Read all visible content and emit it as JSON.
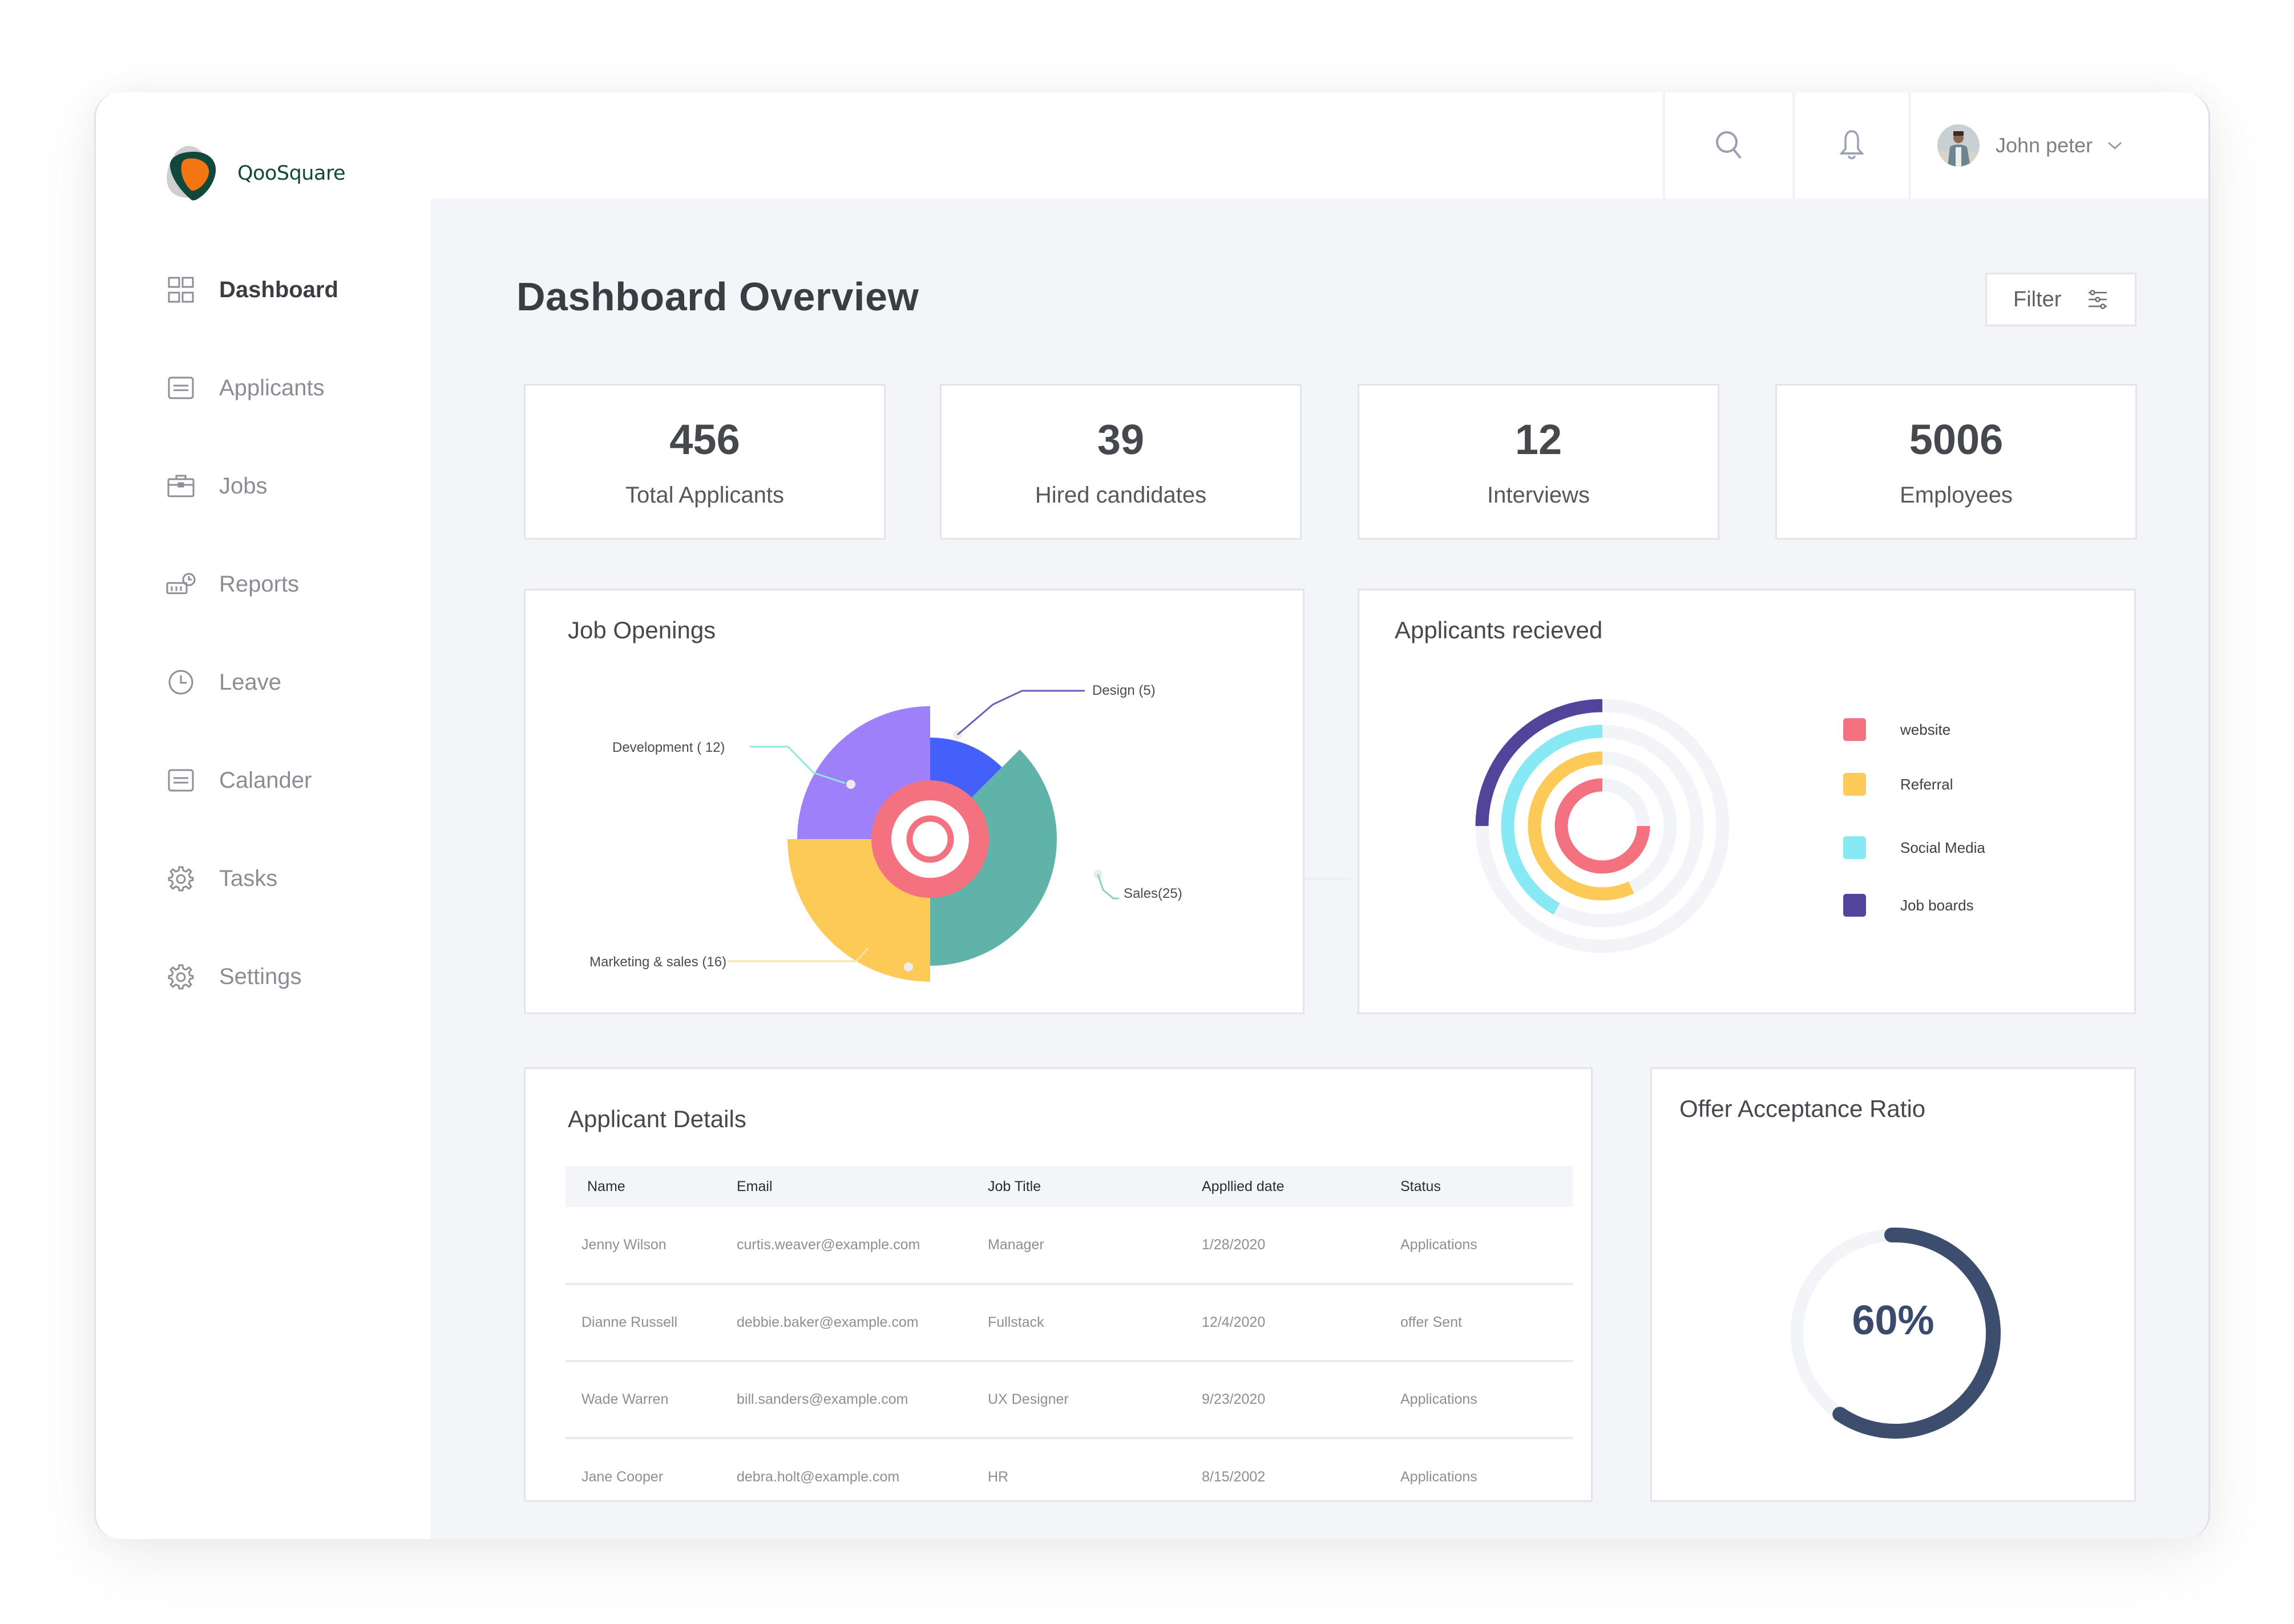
{
  "brand": {
    "name": "QooSquare",
    "logo_icon": "shield-logo"
  },
  "sidebar": {
    "items": [
      {
        "label": "Dashboard",
        "icon": "grid-icon",
        "active": true
      },
      {
        "label": "Applicants",
        "icon": "list-card-icon",
        "active": false
      },
      {
        "label": "Jobs",
        "icon": "briefcase-icon",
        "active": false
      },
      {
        "label": "Reports",
        "icon": "reports-icon",
        "active": false
      },
      {
        "label": "Leave",
        "icon": "clock-icon",
        "active": false
      },
      {
        "label": "Calander",
        "icon": "list-card-icon",
        "active": false
      },
      {
        "label": "Tasks",
        "icon": "gear-icon",
        "active": false
      },
      {
        "label": "Settings",
        "icon": "gear-icon",
        "active": false
      }
    ]
  },
  "topbar": {
    "search_icon": "search-icon",
    "notification_icon": "bell-icon",
    "user": {
      "name": "John peter",
      "dropdown_icon": "chevron-down-icon"
    }
  },
  "page": {
    "title": "Dashboard Overview",
    "filter_label": "Filter",
    "filter_icon": "sliders-icon"
  },
  "stats": [
    {
      "value": "456",
      "label": "Total Applicants"
    },
    {
      "value": "39",
      "label": "Hired candidates"
    },
    {
      "value": "12",
      "label": "Interviews"
    },
    {
      "value": "5006",
      "label": "Employees"
    }
  ],
  "colors": {
    "development": "#9f80fb",
    "design": "#4360fb",
    "sales": "#5fb3a8",
    "marketing": "#fdca57",
    "center_ring": "#f47280",
    "website": "#f47280",
    "referral": "#fdca57",
    "social_media": "#87e9f3",
    "job_boards": "#51459b",
    "track": "#f3f4f8",
    "offer": "#3d4d6e"
  },
  "job_openings": {
    "title": "Job Openings",
    "labels": {
      "development": "Development ( 12)",
      "design": "Design (5)",
      "sales": "Sales(25)",
      "marketing": "Marketing & sales (16)"
    }
  },
  "applicants_received": {
    "title": "Applicants recieved",
    "legend": [
      "website",
      "Referral",
      "Social Media",
      "Job boards"
    ]
  },
  "applicant_details": {
    "title": "Applicant Details",
    "columns": [
      "Name",
      "Email",
      "Job Title",
      "Appllied date",
      "Status"
    ],
    "rows": [
      [
        "Jenny Wilson",
        "curtis.weaver@example.com",
        "Manager",
        "1/28/2020",
        "Applications"
      ],
      [
        "Dianne Russell",
        "debbie.baker@example.com",
        "Fullstack",
        "12/4/2020",
        "offer Sent"
      ],
      [
        "Wade Warren",
        "bill.sanders@example.com",
        "UX Designer",
        "9/23/2020",
        "Applications"
      ],
      [
        "Jane Cooper",
        "debra.holt@example.com",
        "HR",
        "8/15/2002",
        "Applications"
      ]
    ]
  },
  "offer_acceptance": {
    "title": "Offer Acceptance Ratio",
    "value_label": "60%",
    "percent": 60
  },
  "chart_data": [
    {
      "type": "pie",
      "subtype": "polar-area",
      "title": "Job Openings",
      "categories": [
        "Development",
        "Design",
        "Sales",
        "Marketing & sales"
      ],
      "values": [
        12,
        5,
        25,
        16
      ],
      "labels": [
        "Development ( 12)",
        "Design (5)",
        "Sales(25)",
        "Marketing & sales (16)"
      ]
    },
    {
      "type": "pie",
      "subtype": "radial-bar",
      "title": "Applicants recieved",
      "categories": [
        "website",
        "Referral",
        "Social Media",
        "Job boards"
      ],
      "values": [
        75,
        57,
        42,
        25
      ],
      "unit": "percent",
      "legend": "right"
    },
    {
      "type": "pie",
      "subtype": "gauge",
      "title": "Offer Acceptance Ratio",
      "categories": [
        "Accepted"
      ],
      "values": [
        60
      ],
      "unit": "percent"
    }
  ]
}
